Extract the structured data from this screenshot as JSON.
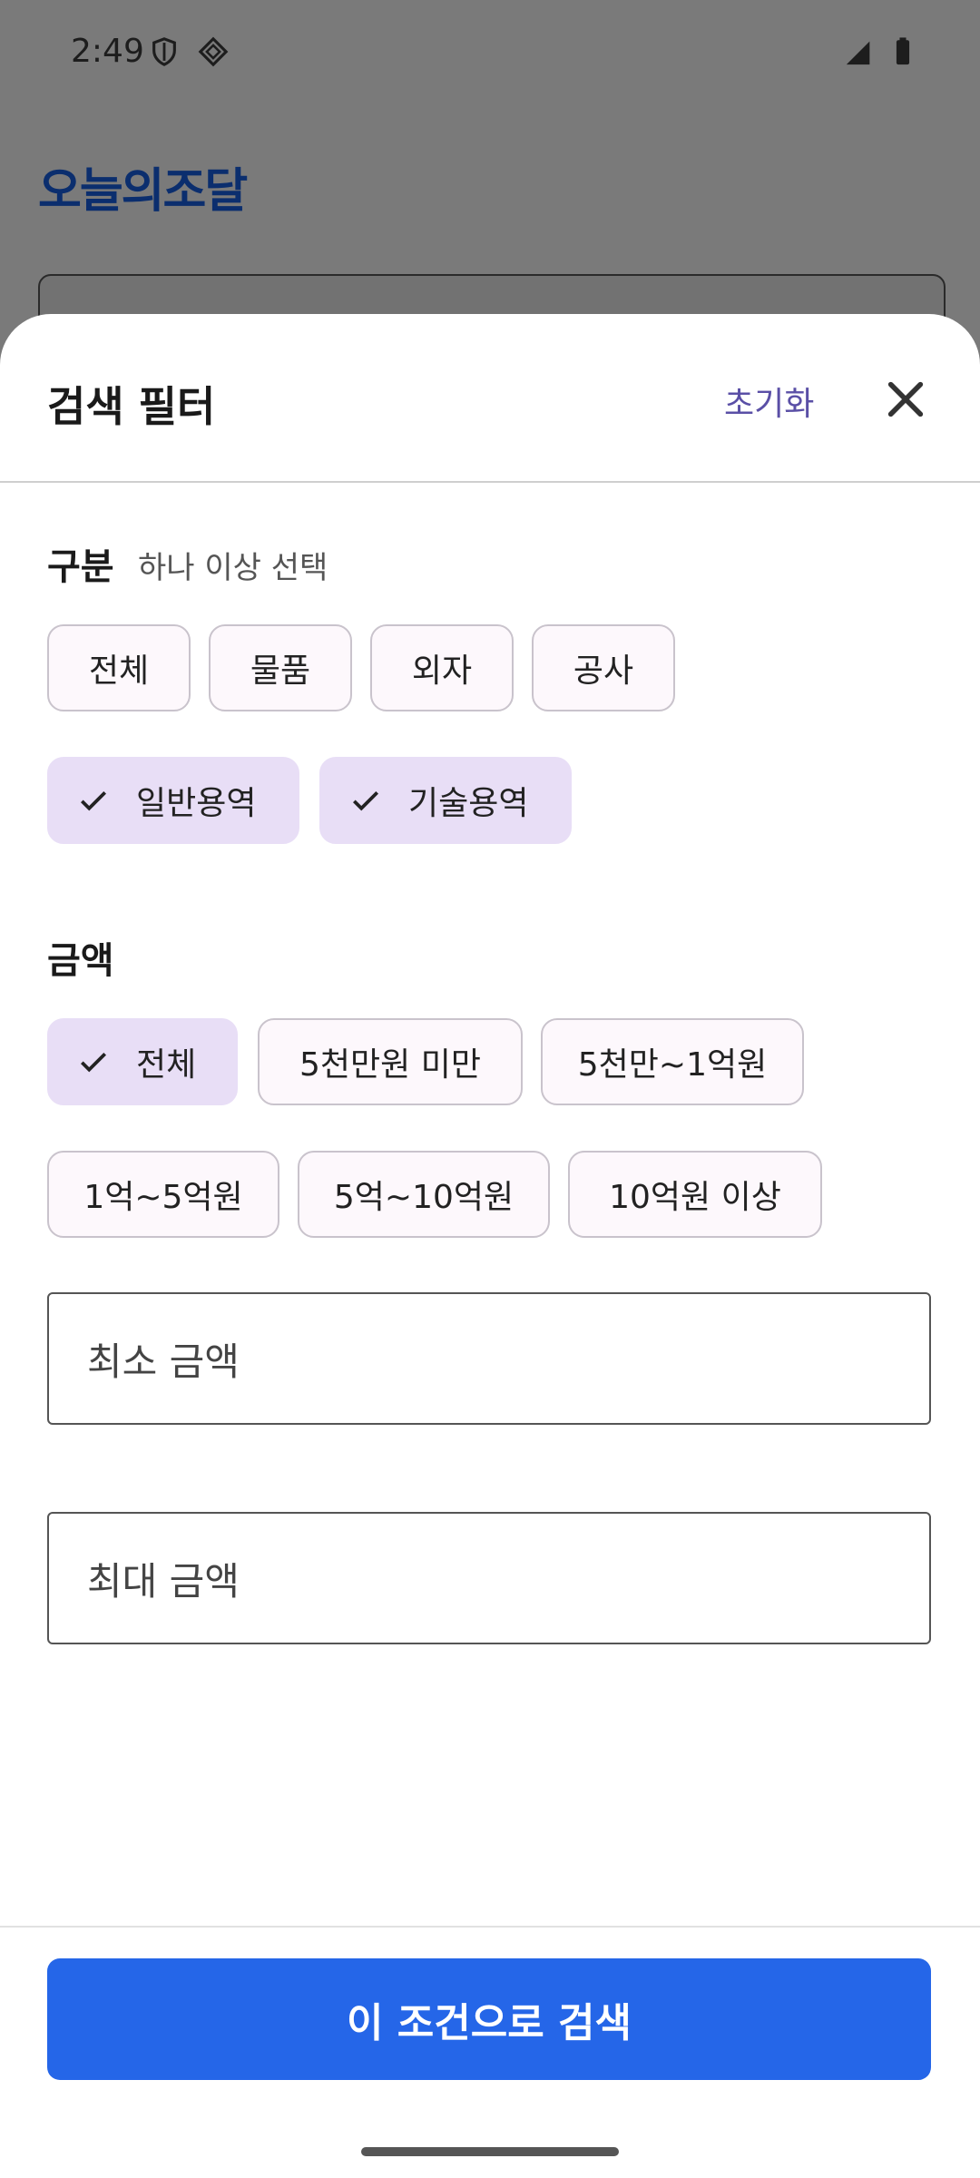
{
  "status_bar": {
    "time": "2:49"
  },
  "app": {
    "logo": "오늘의조달"
  },
  "sheet": {
    "title": "검색 필터",
    "reset_label": "초기화",
    "category": {
      "title": "구분",
      "subtitle": "하나 이상 선택",
      "chips": [
        {
          "label": "전체",
          "selected": false
        },
        {
          "label": "물품",
          "selected": false
        },
        {
          "label": "외자",
          "selected": false
        },
        {
          "label": "공사",
          "selected": false
        },
        {
          "label": "일반용역",
          "selected": true
        },
        {
          "label": "기술용역",
          "selected": true
        }
      ]
    },
    "amount": {
      "title": "금액",
      "chips": [
        {
          "label": "전체",
          "selected": true
        },
        {
          "label": "5천만원 미만",
          "selected": false
        },
        {
          "label": "5천만~1억원",
          "selected": false
        },
        {
          "label": "1억~5억원",
          "selected": false
        },
        {
          "label": "5억~10억원",
          "selected": false
        },
        {
          "label": "10억원 이상",
          "selected": false
        }
      ],
      "min_placeholder": "최소 금액",
      "max_placeholder": "최대 금액"
    },
    "search_button": "이 조건으로 검색"
  },
  "colors": {
    "accent": "#2566e8",
    "chip_selected": "#e8def6",
    "reset": "#5a4fa6"
  }
}
